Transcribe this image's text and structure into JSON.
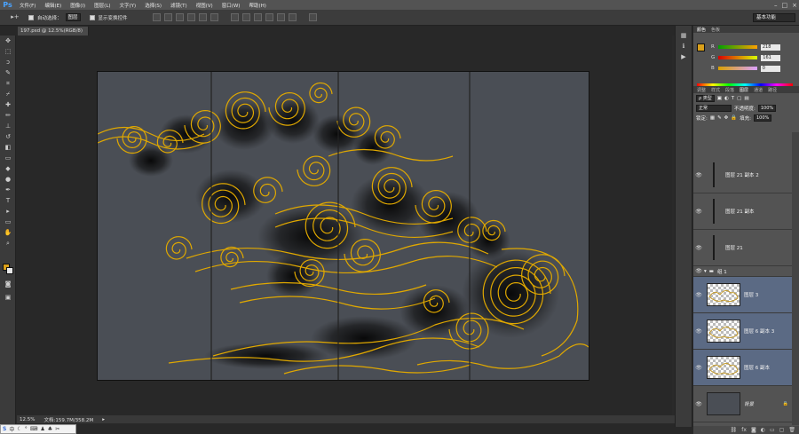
{
  "app": {
    "logo": "Ps"
  },
  "menu": [
    "文件(F)",
    "编辑(E)",
    "图像(I)",
    "图层(L)",
    "文字(Y)",
    "选择(S)",
    "滤镜(T)",
    "视图(V)",
    "窗口(W)",
    "帮助(H)"
  ],
  "window_controls": [
    "–",
    "□",
    "×"
  ],
  "options": {
    "auto_select_label": "自动选择：",
    "auto_select_value": "图层",
    "show_transform_label": "显示变换控件",
    "workspace": "基本功能"
  },
  "document": {
    "tab_title": "197.psd @ 12.5%(RGB/8)",
    "colors": {
      "background": "#4a4e55",
      "line": "#e0a800",
      "shadow": "#0c0c0c"
    }
  },
  "status": {
    "zoom": "12.5%",
    "doc_info": "文档:159.7M/358.2M"
  },
  "ime": {
    "label": "中"
  },
  "color_panel": {
    "tabs": [
      "颜色",
      "色板"
    ],
    "fg_color": "#daa01a",
    "channels": [
      {
        "label": "R",
        "value": "218"
      },
      {
        "label": "G",
        "value": "161"
      },
      {
        "label": "B",
        "value": "0"
      }
    ]
  },
  "layers_panel": {
    "tabs": [
      "调整",
      "样式",
      "段落",
      "图层",
      "通道",
      "路径"
    ],
    "filter_label": "ρ 类型",
    "blend_mode": "正常",
    "opacity_label": "不透明度:",
    "opacity_value": "100%",
    "lock_label": "锁定:",
    "fill_label": "填充:",
    "fill_value": "100%",
    "layers": [
      {
        "name": "图层 21 副本 2",
        "type": "solid"
      },
      {
        "name": "图层 21 副本",
        "type": "solid"
      },
      {
        "name": "图层 21",
        "type": "solid"
      },
      {
        "name": "组 1",
        "type": "group"
      },
      {
        "name": "图层 3",
        "type": "pattern",
        "selected": true
      },
      {
        "name": "图层 6 副本 3",
        "type": "pattern",
        "selected": true
      },
      {
        "name": "图层 6 副本",
        "type": "pattern",
        "selected": true
      },
      {
        "name": "背景",
        "type": "background"
      }
    ]
  }
}
